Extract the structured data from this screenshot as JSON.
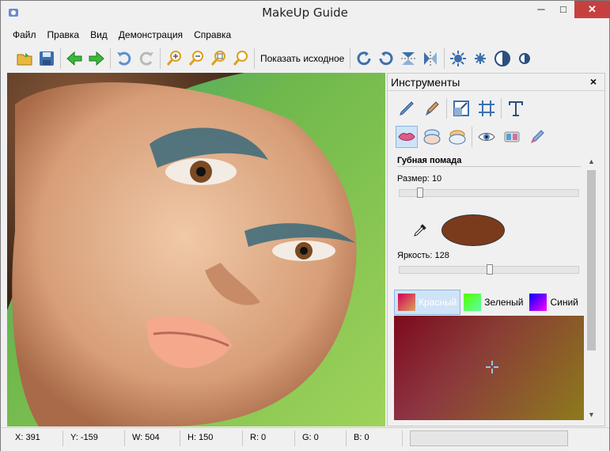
{
  "window": {
    "title": "MakeUp Guide",
    "minimize": "─",
    "maximize": "□",
    "close": "✕"
  },
  "menu": [
    "Файл",
    "Правка",
    "Вид",
    "Демонстрация",
    "Справка"
  ],
  "toolbar": {
    "show_original_label": "Показать исходное"
  },
  "panel": {
    "title": "Инструменты",
    "close": "×",
    "section_title": "Губная помада",
    "size_label": "Размер:",
    "size_value": "10",
    "brightness_label": "Яркость:",
    "brightness_value": "128",
    "size_slider_fraction": 0.1,
    "brightness_slider_fraction": 0.5,
    "color_swatch": "#7a3b1c",
    "tabs": [
      "Красный",
      "Зеленый",
      "Синий"
    ]
  },
  "status": {
    "x": "X: 391",
    "y": "Y: -159",
    "w": "W: 504",
    "h": "H: 150",
    "r": "R: 0",
    "g": "G: 0",
    "b": "B: 0"
  }
}
